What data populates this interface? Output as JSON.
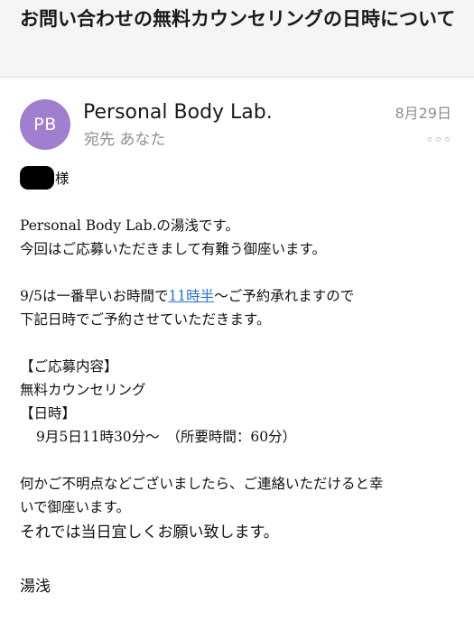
{
  "subject": "お問い合わせの無料カウンセリングの日時について",
  "sender": {
    "initials": "PB",
    "name": "Personal Body Lab.",
    "recipient": "宛先 あなた",
    "date": "8月29日",
    "avatar_color": "#a07fd0"
  },
  "more_label": "◦◦◦",
  "body": {
    "salutation": "様",
    "intro_1": "Personal Body Lab.の湯浅です。",
    "intro_2": "今回はご応募いただきまして有難う御座います。",
    "avail_prefix": "9/5は一番早いお時間で",
    "avail_link": "11時半",
    "avail_suffix": "〜ご予約承れますので",
    "avail_2": "下記日時でご予約させていただきます。",
    "section_1": "【ご応募内容】",
    "section_1_value": "無料カウンセリング",
    "section_2": "【日時】",
    "section_2_value": "9月5日11時30分〜　（所要時間：60分）",
    "contact_1": "何かご不明点などございましたら、ご連絡いただけると幸",
    "contact_2": "いで御座います。",
    "closing": "それでは当日宜しくお願い致します。",
    "signature": "湯浅"
  },
  "colors": {
    "link": "#2a6fd6",
    "header_bg": "#f5f5f5",
    "meta_gray": "#8e8e93"
  }
}
